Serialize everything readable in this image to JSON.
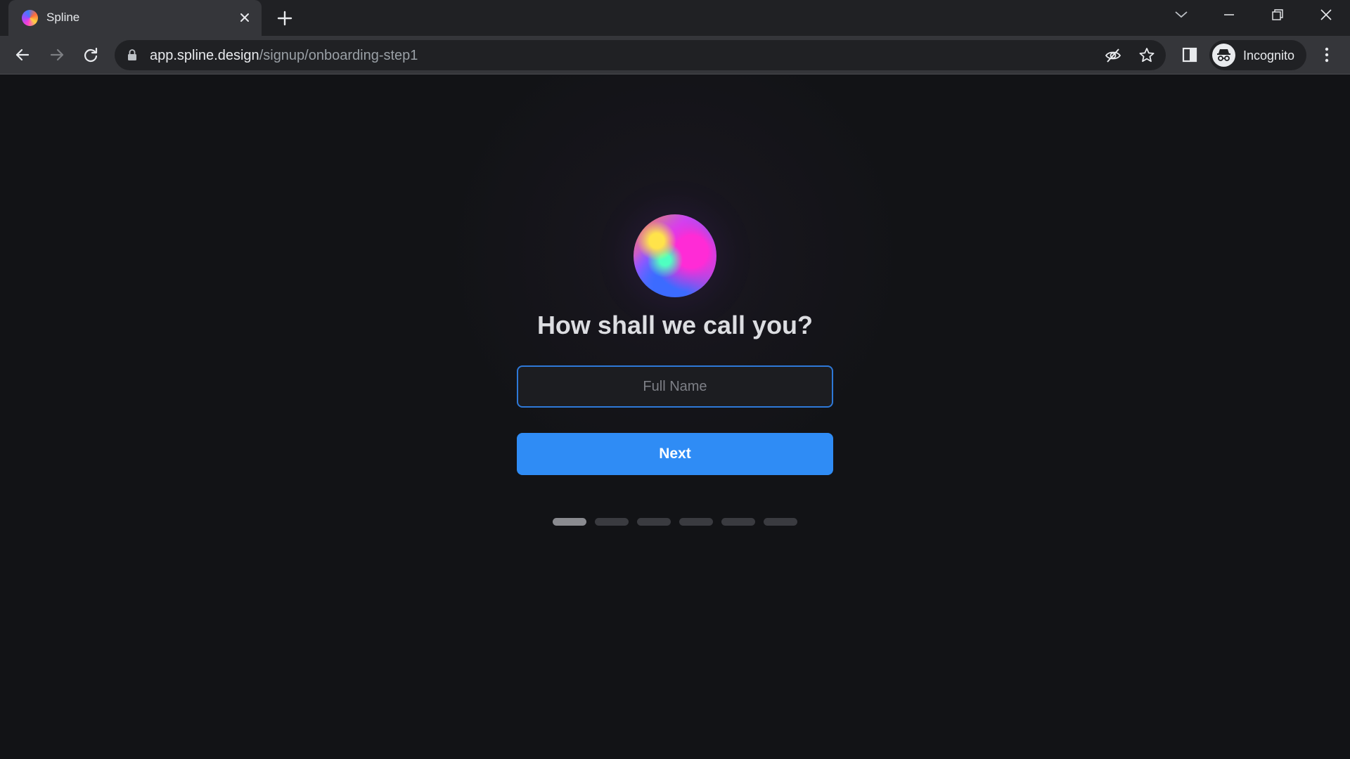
{
  "browser": {
    "tab": {
      "title": "Spline"
    },
    "url": {
      "host": "app.spline.design",
      "path": "/signup/onboarding-step1"
    },
    "profile_label": "Incognito"
  },
  "onboarding": {
    "heading": "How shall we call you?",
    "name_input": {
      "placeholder": "Full Name",
      "value": ""
    },
    "next_label": "Next",
    "progress": {
      "total_steps": 6,
      "current_step": 1
    }
  },
  "colors": {
    "page_bg": "#121316",
    "accent": "#2f8cf5",
    "input_border": "#2e79d8"
  }
}
